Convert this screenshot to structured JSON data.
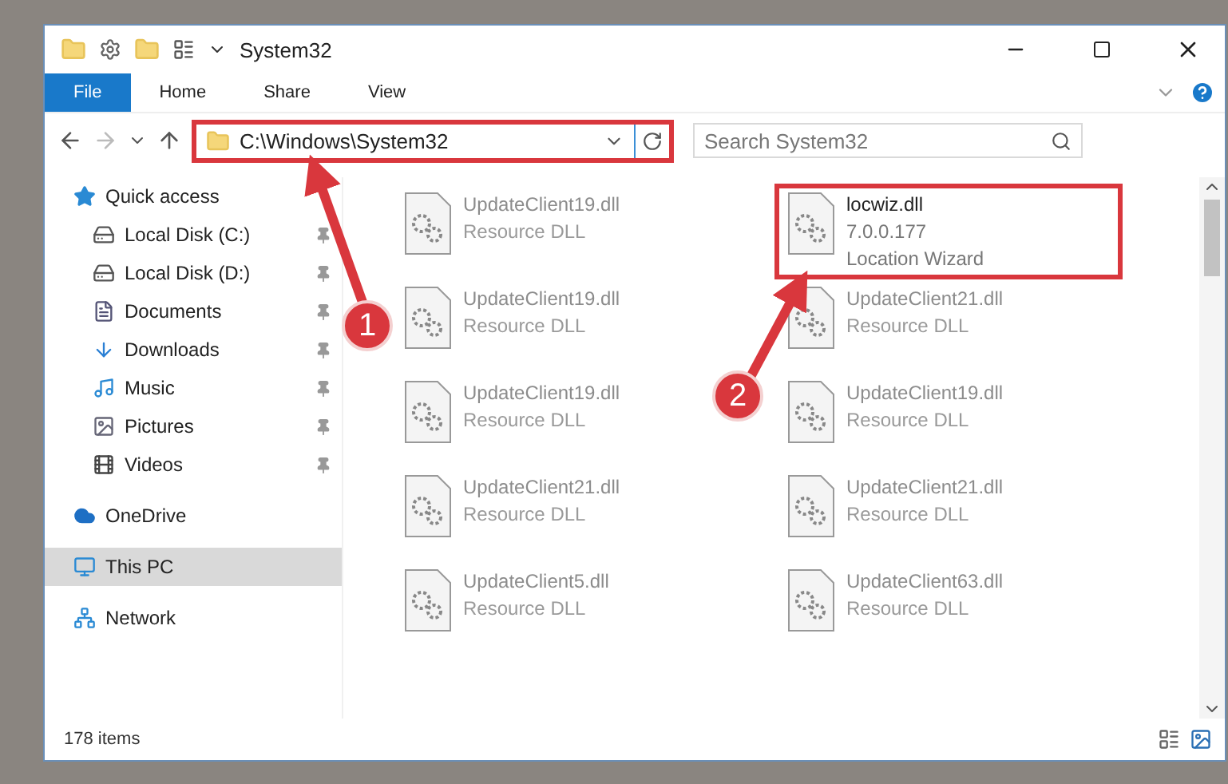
{
  "window": {
    "title": "System32"
  },
  "ribbon_tabs": [
    {
      "label": "File",
      "kind": "file",
      "selected": false
    },
    {
      "label": "Home",
      "kind": "tab",
      "selected": false
    },
    {
      "label": "Share",
      "kind": "tab",
      "selected": false
    },
    {
      "label": "View",
      "kind": "tab",
      "selected": false
    }
  ],
  "address": {
    "path": "C:\\Windows\\System32",
    "highlighted": true
  },
  "search": {
    "placeholder": "Search System32"
  },
  "sidebar": {
    "items": [
      {
        "label": "Quick access",
        "group": true,
        "pinned": false,
        "selected": false
      },
      {
        "label": "Local Disk (C:)",
        "group": false,
        "pinned": true,
        "selected": false
      },
      {
        "label": "Local Disk (D:)",
        "group": false,
        "pinned": true,
        "selected": false
      },
      {
        "label": "Documents",
        "group": false,
        "pinned": true,
        "selected": false
      },
      {
        "label": "Downloads",
        "group": false,
        "pinned": true,
        "selected": false
      },
      {
        "label": "Music",
        "group": false,
        "pinned": true,
        "selected": false
      },
      {
        "label": "Pictures",
        "group": false,
        "pinned": true,
        "selected": false
      },
      {
        "label": "Videos",
        "group": false,
        "pinned": true,
        "selected": false
      },
      {
        "label": "OneDrive",
        "group": true,
        "pinned": false,
        "selected": false
      },
      {
        "label": "This PC",
        "group": true,
        "pinned": false,
        "selected": true
      },
      {
        "label": "Network",
        "group": true,
        "pinned": false,
        "selected": false
      }
    ]
  },
  "files": [
    {
      "name": "UpdateClient19.dll",
      "lines": [
        "Resource DLL"
      ],
      "faded": true,
      "highlighted": false
    },
    {
      "name": "locwiz.dll",
      "lines": [
        "7.0.0.177",
        "Location Wizard"
      ],
      "faded": false,
      "highlighted": true
    },
    {
      "name": "UpdateClient19.dll",
      "lines": [
        "Resource DLL"
      ],
      "faded": true,
      "highlighted": false
    },
    {
      "name": "UpdateClient21.dll",
      "lines": [
        "Resource DLL"
      ],
      "faded": true,
      "highlighted": false
    },
    {
      "name": "UpdateClient19.dll",
      "lines": [
        "Resource DLL"
      ],
      "faded": true,
      "highlighted": false
    },
    {
      "name": "UpdateClient19.dll",
      "lines": [
        "Resource DLL"
      ],
      "faded": true,
      "highlighted": false
    },
    {
      "name": "UpdateClient21.dll",
      "lines": [
        "Resource DLL"
      ],
      "faded": true,
      "highlighted": false
    },
    {
      "name": "UpdateClient21.dll",
      "lines": [
        "Resource DLL"
      ],
      "faded": true,
      "highlighted": false
    },
    {
      "name": "UpdateClient5.dll",
      "lines": [
        "Resource DLL"
      ],
      "faded": true,
      "highlighted": false
    },
    {
      "name": "UpdateClient63.dll",
      "lines": [
        "Resource DLL"
      ],
      "faded": true,
      "highlighted": false
    }
  ],
  "status_bar": {
    "count": "178 items"
  },
  "annotations": [
    {
      "label": "1"
    },
    {
      "label": "2"
    }
  ]
}
